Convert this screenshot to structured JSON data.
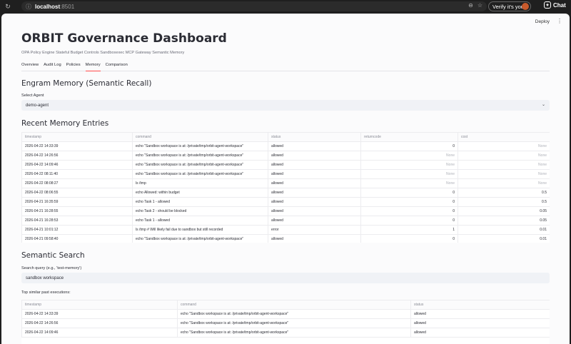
{
  "browser": {
    "url_host": "localhost",
    "url_port": ":8501",
    "verify_label": "Verify it's you",
    "chat_label": "Chat"
  },
  "header": {
    "deploy_label": "Deploy"
  },
  "app": {
    "title": "ORBIT Governance Dashboard",
    "subtitle": "OPA Policy Engine Stateful Budget Controls Sandboxexec MCP Gateway Semantic Memory"
  },
  "tabs": [
    "Overview",
    "Audit Log",
    "Policies",
    "Memory",
    "Comparison"
  ],
  "active_tab": "Memory",
  "memory": {
    "heading": "Engram Memory (Semantic Recall)",
    "agent_label": "Select Agent",
    "agent_value": "demo-agent",
    "entries_heading": "Recent Memory Entries",
    "columns": [
      "timestamp",
      "command",
      "status",
      "returncode",
      "cost"
    ],
    "rows": [
      [
        "2026-04-22 14:33:39",
        "echo \"Sandbox workspace is at: /private/tmp/orbit-agent-workspace\"",
        "allowed",
        "0",
        "None"
      ],
      [
        "2026-04-22 14:26:56",
        "echo \"Sandbox workspace is at: /private/tmp/orbit-agent-workspace\"",
        "allowed",
        "None",
        "None"
      ],
      [
        "2026-04-22 14:09:46",
        "echo \"Sandbox workspace is at: /private/tmp/orbit-agent-workspace\"",
        "allowed",
        "None",
        "None"
      ],
      [
        "2026-04-22 08:11:40",
        "echo \"Sandbox workspace is at: /private/tmp/orbit-agent-workspace\"",
        "allowed",
        "None",
        "None"
      ],
      [
        "2026-04-22 08:08:27",
        "ls /tmp",
        "allowed",
        "None",
        "None"
      ],
      [
        "2026-04-22 08:06:55",
        "echo Allowed: within budget",
        "allowed",
        "0",
        "0.5"
      ],
      [
        "2026-04-21 16:35:59",
        "echo Task 1 - allowed",
        "allowed",
        "0",
        "0.5"
      ],
      [
        "2026-04-21 16:28:55",
        "echo Task 2 - should be blocked",
        "allowed",
        "0",
        "0.05"
      ],
      [
        "2026-04-21 16:28:53",
        "echo Task 1 - allowed",
        "allowed",
        "0",
        "0.05"
      ],
      [
        "2026-04-21 10:01:12",
        "ls /tmp # Will likely fail due to sandbox but still recorded",
        "error",
        "1",
        "0.01"
      ],
      [
        "2026-04-21 09:58:40",
        "echo \"Sandbox workspace is at: /private/tmp/orbit-agent-workspace\"",
        "allowed",
        "0",
        "0.01"
      ]
    ]
  },
  "search": {
    "heading": "Semantic Search",
    "query_label": "Search query (e.g., 'test-memory')",
    "query_value": "sandbox workspace",
    "results_caption": "Top similar past executions:",
    "columns": [
      "timestamp",
      "command",
      "status"
    ],
    "rows": [
      [
        "2026-04-22 14:33:39",
        "echo \"Sandbox workspace is at: /private/tmp/orbit-agent-workspace\"",
        "allowed"
      ],
      [
        "2026-04-22 14:26:56",
        "echo \"Sandbox workspace is at: /private/tmp/orbit-agent-workspace\"",
        "allowed"
      ],
      [
        "2026-04-22 14:09:46",
        "echo \"Sandbox workspace is at: /private/tmp/orbit-agent-workspace\"",
        "allowed"
      ]
    ]
  },
  "colors": {
    "accent": "#ff4b4b",
    "input_bg": "#f0f2f6",
    "text": "#2b2c34"
  }
}
